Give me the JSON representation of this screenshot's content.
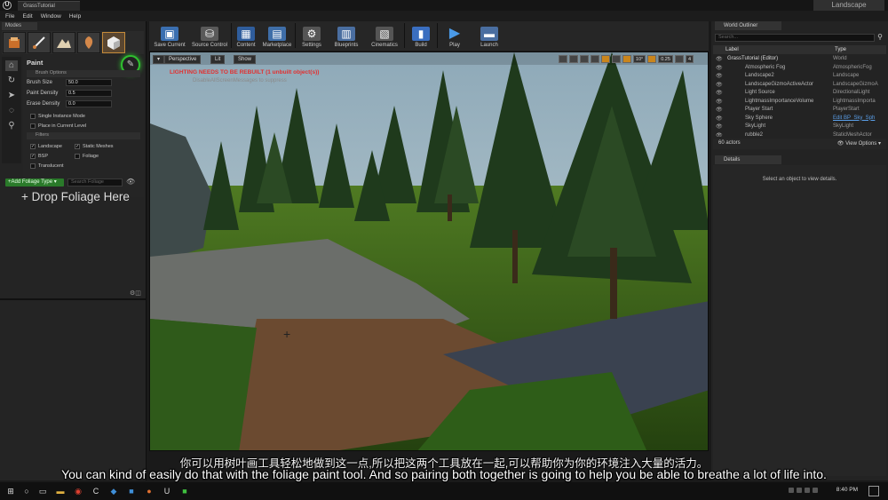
{
  "window": {
    "doc_tab": "GrassTutorial",
    "app_tab": "Landscape",
    "logo": "U"
  },
  "menu": [
    "File",
    "Edit",
    "Window",
    "Help"
  ],
  "modes": {
    "tab_label": "Modes",
    "tool_icons": [
      "place-mode-icon",
      "paint-mode-icon",
      "landscape-mode-icon",
      "foliage-mode-icon",
      "geometry-mode-icon"
    ],
    "side_icons": [
      "select-icon",
      "paint-icon",
      "reapply-icon",
      "lasso-icon",
      "fill-icon"
    ],
    "paint_title": "Paint",
    "brush_options_header": "Brush Options",
    "brush_size_label": "Brush Size",
    "brush_size_value": "50.0",
    "paint_density_label": "Paint Density",
    "paint_density_value": "0.5",
    "erase_density_label": "Erase Density",
    "erase_density_value": "0.0",
    "single_instance": "Single Instance Mode",
    "place_current_level": "Place in Current Level",
    "filters_header": "Filters",
    "filters": [
      {
        "label": "Landscape",
        "checked": true
      },
      {
        "label": "Static Meshes",
        "checked": true
      },
      {
        "label": "BSP",
        "checked": true
      },
      {
        "label": "Foliage",
        "checked": false
      },
      {
        "label": "Translucent",
        "checked": false
      }
    ],
    "add_foliage_type": "+Add Foliage Type ▾",
    "search_foliage_placeholder": "Search Foliage",
    "drop_foliage": "+ Drop Foliage Here"
  },
  "toolbar": [
    {
      "label": "Save Current",
      "color": "#3b6fb0",
      "glyph": "▣"
    },
    {
      "label": "Source Control",
      "color": "#5a5a5a",
      "glyph": "⛁"
    },
    {
      "label": "Content",
      "color": "#2f5d9c",
      "glyph": "▦"
    },
    {
      "label": "Marketplace",
      "color": "#3f6ea8",
      "glyph": "▤"
    },
    {
      "label": "Settings",
      "color": "#555",
      "glyph": "⚙"
    },
    {
      "label": "Blueprints",
      "color": "#4a6ea0",
      "glyph": "▥"
    },
    {
      "label": "Cinematics",
      "color": "#555",
      "glyph": "🎬"
    },
    {
      "label": "Build",
      "color": "#3a6ec0",
      "glyph": "▮"
    },
    {
      "label": "Play",
      "color": "#3f8fd8",
      "glyph": "▶"
    },
    {
      "label": "Launch",
      "color": "#4a6ea0",
      "glyph": "▬"
    }
  ],
  "viewport": {
    "perspective": "Perspective",
    "lit": "Lit",
    "show": "Show",
    "warning": "LIGHTING NEEDS TO BE REBUILT (1 unbuilt object(s))",
    "warning2": "DisableAllScreenMessages to suppress",
    "snap_angle": "10°",
    "snap_scale": "0.25",
    "cam_speed": "4"
  },
  "outliner": {
    "tab_label": "World Outliner",
    "search_placeholder": "Search...",
    "col_label": "Label",
    "col_type": "Type",
    "rows": [
      {
        "label": "GrassTutorial (Editor)",
        "type": "World",
        "indent": 0
      },
      {
        "label": "Atmospheric Fog",
        "type": "AtmosphericFog",
        "indent": 1
      },
      {
        "label": "Landscape2",
        "type": "Landscape",
        "indent": 1
      },
      {
        "label": "LandscapeGizmoActiveActor",
        "type": "LandscapeGizmoA",
        "indent": 1
      },
      {
        "label": "Light Source",
        "type": "DirectionalLight",
        "indent": 1
      },
      {
        "label": "LightmassImportanceVolume",
        "type": "LightmassImporta",
        "indent": 1
      },
      {
        "label": "Player Start",
        "type": "PlayerStart",
        "indent": 1
      },
      {
        "label": "Sky Sphere",
        "type": "Edit BP_Sky_Sph",
        "indent": 1,
        "link": true
      },
      {
        "label": "SkyLight",
        "type": "SkyLight",
        "indent": 1
      },
      {
        "label": "rubble2",
        "type": "StaticMeshActor",
        "indent": 1
      }
    ],
    "actor_count": "60 actors",
    "view_options": "👁 View Options ▾"
  },
  "details": {
    "tab_label": "Details",
    "message": "Select an object to view details."
  },
  "subtitles": {
    "zh": "你可以用树叶画工具轻松地做到这一点,所以把这两个工具放在一起,可以帮助你为你的环境注入大量的活力。",
    "en": "You can kind of easily do that with the foliage paint tool. And so pairing both together is going to help you be able to breathe a lot of life into."
  },
  "taskbar": {
    "time": "8:40 PM",
    "items": [
      "start-icon",
      "search-icon",
      "task-view-icon",
      "explorer-icon",
      "chrome-icon",
      "app-c-icon",
      "app-m-icon",
      "app-s-icon",
      "app-p-icon",
      "unreal-icon",
      "app-green-icon"
    ]
  },
  "colors": {
    "accent_green": "#2fbf2f",
    "warning_red": "#e23030",
    "link_blue": "#5a9ee8"
  }
}
